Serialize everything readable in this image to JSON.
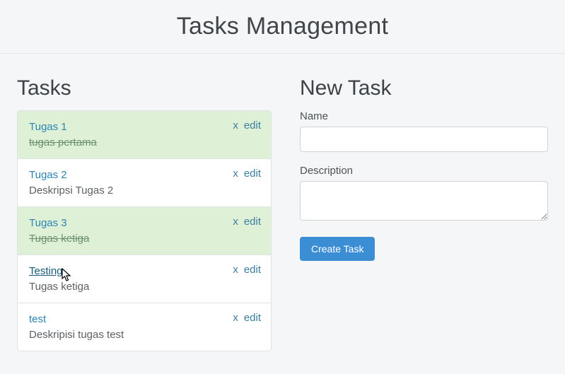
{
  "header": {
    "title": "Tasks Management"
  },
  "tasks_section": {
    "title": "Tasks",
    "actions": {
      "delete": "x",
      "edit": "edit"
    },
    "items": [
      {
        "title": "Tugas 1",
        "description": "tugas pertama",
        "done": true,
        "hovered": false
      },
      {
        "title": "Tugas 2",
        "description": "Deskripsi Tugas 2",
        "done": false,
        "hovered": false
      },
      {
        "title": "Tugas 3",
        "description": "Tugas ketiga",
        "done": true,
        "hovered": false
      },
      {
        "title": "Testing",
        "description": "Tugas ketiga",
        "done": false,
        "hovered": true
      },
      {
        "title": "test",
        "description": "Deskripisi tugas test",
        "done": false,
        "hovered": false
      }
    ]
  },
  "new_task": {
    "title": "New Task",
    "name_label": "Name",
    "name_value": "",
    "description_label": "Description",
    "description_value": "",
    "submit_label": "Create Task"
  }
}
